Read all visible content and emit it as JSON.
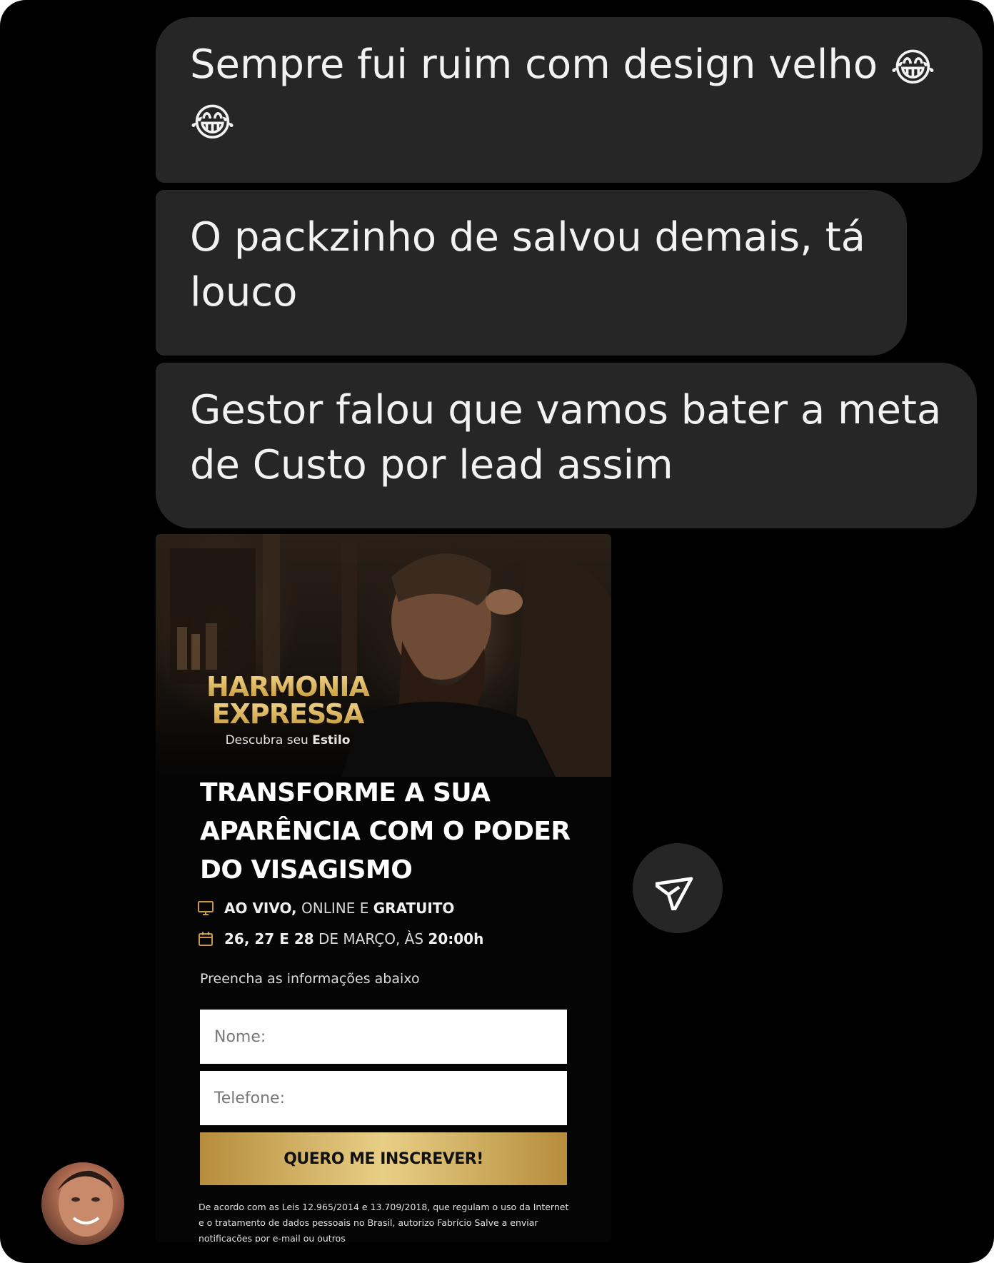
{
  "messages": [
    {
      "text": "Sempre fui ruim com design velho ",
      "emoji": [
        "😂",
        "😂"
      ]
    },
    {
      "text": "O packzinho de salvou demais, tá louco"
    },
    {
      "text": "Gestor falou que vamos bater a meta de Custo por lead assim"
    }
  ],
  "ad": {
    "brand_line1": "HARMONIA",
    "brand_line2": "EXPRESSA",
    "brand_sub_prefix": "Descubra seu ",
    "brand_sub_bold": "Estilo",
    "headline": "TRANSFORME A SUA APARÊNCIA COM O PODER DO VISAGISMO",
    "live_bold": "AO VIVO,",
    "live_mid": " ONLINE E ",
    "live_bold2": "GRATUITO",
    "date_bold": "26, 27 E 28",
    "date_mid": " DE MARÇO, ÀS ",
    "date_bold2": "20:00h",
    "form_note": "Preencha as informações abaixo",
    "name_placeholder": "Nome:",
    "phone_placeholder": "Telefone:",
    "cta": "QUERO ME INSCREVER!",
    "legal": "De acordo com as Leis 12.965/2014 e 13.709/2018, que regulam o uso da Internet e o tratamento de dados pessoais no Brasil, autorizo Fabrício Salve a enviar notificações por e-mail ou outros"
  },
  "icons": {
    "share": "paper-plane-icon",
    "monitor": "monitor-icon",
    "calendar": "calendar-icon"
  },
  "colors": {
    "background": "#000000",
    "bubble": "#262626",
    "gold": "#d8b25a"
  }
}
